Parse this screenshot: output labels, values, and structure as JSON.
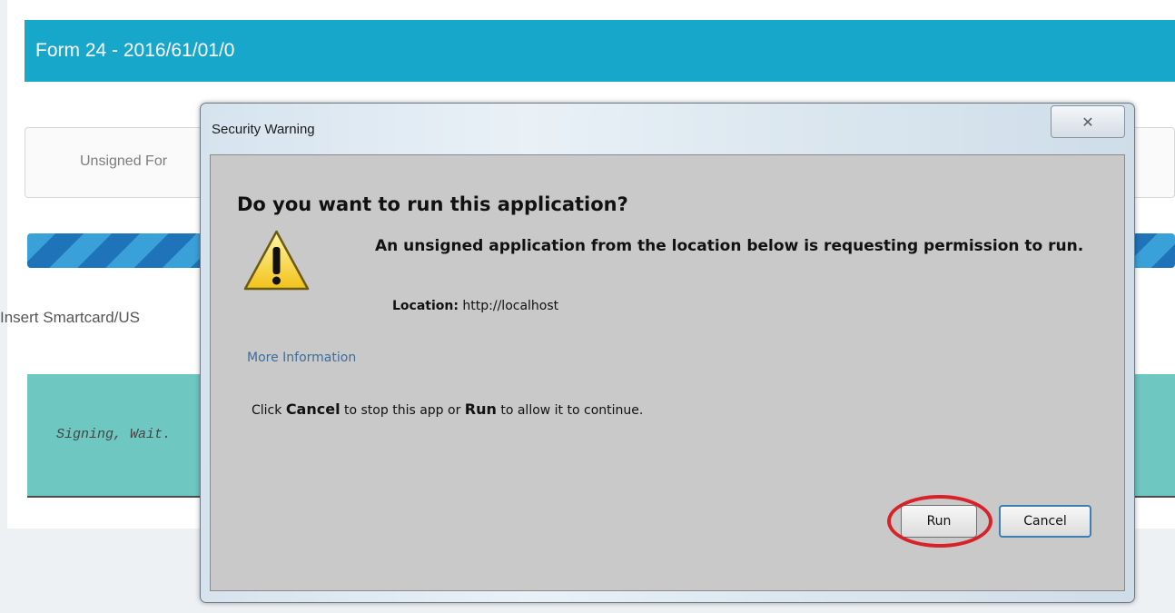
{
  "page": {
    "form_title": "Form 24 - 2016/61/01/0",
    "tab_label": "Unsigned For",
    "progress": 1.0,
    "insert_text": "Insert Smartcard/US",
    "signing_text": "Signing, Wait."
  },
  "dialog": {
    "title": "Security Warning",
    "close_glyph": "✕",
    "question": "Do you want to run this application?",
    "icon": "warning-triangle-icon",
    "message": "An unsigned application from the location below is requesting permission to run.",
    "location_label": "Location:",
    "location_value": "http://localhost",
    "more_info": "More Information",
    "instruction": {
      "part1": "Click ",
      "cancel_word": "Cancel",
      "part2": " to stop this app or ",
      "run_word": "Run",
      "part3": " to allow it to continue."
    },
    "run_label": "Run",
    "cancel_label": "Cancel",
    "highlight_color": "#d8222a"
  }
}
